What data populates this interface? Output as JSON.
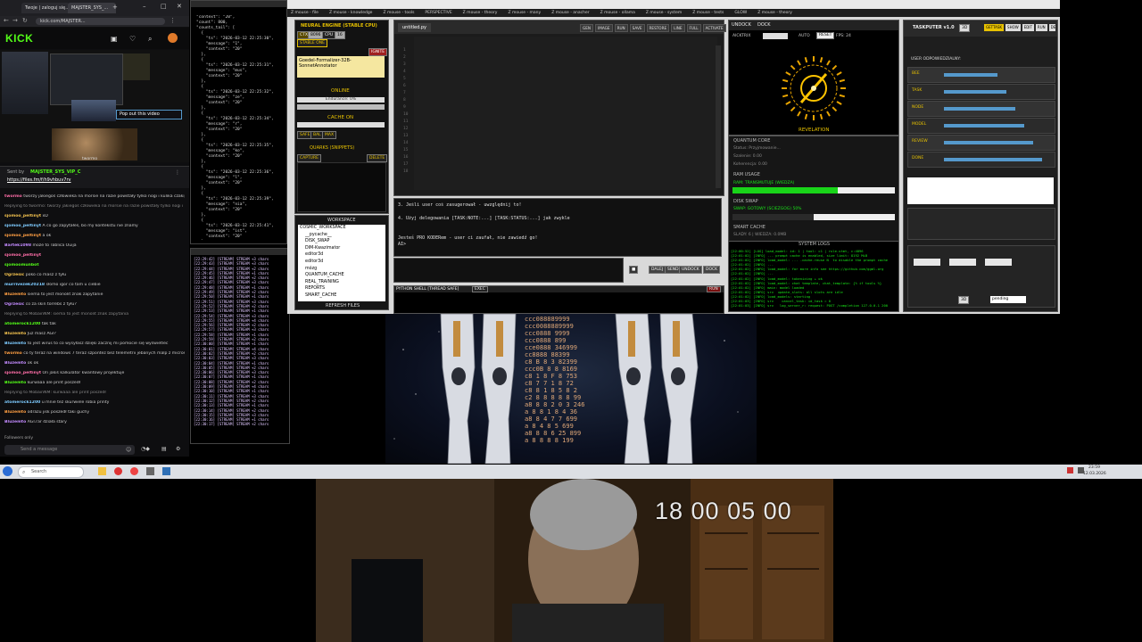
{
  "browser": {
    "tabs": [
      "Twoje | zaloguj się...",
      "MAJSTER_SYS_..."
    ],
    "url": "kick.com/MAJSTER...",
    "site_logo": "KICK",
    "popout_label": "Pop out this video",
    "streamer_name": "twormo",
    "pinned_by": "Sent by",
    "pinned_user": "MAJSTER_SYS_VIP_C",
    "pinned_link": "https://files.fm/f/h9vhbuv7rv",
    "chat": [
      {
        "user": "twormo",
        "text": "tworzy jakiegoś człowieka na morsie na razie powstały tylko nogi i kulika czakijny dała"
      },
      {
        "user": "",
        "text": "Replying to twormo: tworzy jakiegoś człowieka na morsie na razie powstały tylko nogi i"
      },
      {
        "user": "sjomoo_peltinyt",
        "text": "xD"
      },
      {
        "user": "sjomoo_peltinyt",
        "text": "A co go zapytałeś, bo my kontekstu nie znamy"
      },
      {
        "user": "sjomoo_peltinyt",
        "text": "a ok"
      },
      {
        "user": "Bartek1098",
        "text": "może to Tablica Ouija"
      },
      {
        "user": "sjomoo_peltinyt",
        "text": ""
      },
      {
        "user": "sjomoomunbot",
        "text": ""
      },
      {
        "user": "Ogrzesic",
        "text": "poko co masz z tyłu"
      },
      {
        "user": "murrivezek20218",
        "text": "słomo igor co tam u ciebie"
      },
      {
        "user": "Bluzemto",
        "text": "siema to jest monolit znak zapytanie"
      },
      {
        "user": "Ogrzesic",
        "text": "co za skin torrebs z tyłu?"
      },
      {
        "user": "",
        "text": "Replying to MobainNM: siema to jest monolit znak zapytania"
      },
      {
        "user": "atomerock1200",
        "text": "tak tak"
      },
      {
        "user": "Bluzemto",
        "text": "Juz masz AGI?"
      },
      {
        "user": "Bluzemto",
        "text": "to jest wirus to co wysyłasz dzięki zacznij mi pomocie się wyświetlec"
      },
      {
        "user": "twormo",
        "text": "co ty teraz na windows 7 teraz szpontez bez telemetrii jebanych malp z microsoftu?"
      },
      {
        "user": "Bluzemto",
        "text": "ok ok"
      },
      {
        "user": "sjomoo_peltinyt",
        "text": "On jakiś kalkulator kwantowy projektuje"
      },
      {
        "user": "Bluzemto",
        "text": "kurwaaa ale print poszedł"
      },
      {
        "user": "",
        "text": "Replying to MobainNM: kurwaaa ale print poszedł"
      },
      {
        "user": "atomerock1200",
        "text": "u mnie też skurwiele robia printy"
      },
      {
        "user": "Bluzemto",
        "text": "odrazu jisk poszedł taki guchy"
      },
      {
        "user": "Bluzemto",
        "text": "AGI.rar działa stary"
      }
    ],
    "followers_only": "Followers only",
    "send_placeholder": "Send a message"
  },
  "json_terminal": {
    "lines": [
      "\"context\": \"20\",",
      "\"count\": 800,",
      "\"counts_tail\": [",
      "  {",
      "    \"ts\": \"2026-03-12 22:25:30\",",
      "    \"message\": \"1\",",
      "    \"context\": \"20\"",
      "  },",
      "  {",
      "    \"ts\": \"2026-03-12 22:25:31\",",
      "    \"message\": \"mus\",",
      "    \"context\": \"20\"",
      "  },",
      "  {",
      "    \"ts\": \"2026-03-12 22:25:32\",",
      "    \"message\": \"ze\",",
      "    \"context\": \"20\"",
      "  },",
      "  {",
      "    \"ts\": \"2026-03-12 22:25:34\",",
      "    \"message\": \"r\",",
      "    \"context\": \"20\"",
      "  },",
      "  {",
      "    \"ts\": \"2026-03-12 22:25:35\",",
      "    \"message\": \"ko\",",
      "    \"context\": \"20\"",
      "  },",
      "  {",
      "    \"ts\": \"2026-03-12 22:25:36\",",
      "    \"message\": \"l\",",
      "    \"context\": \"20\"",
      "  },",
      "  {",
      "    \"ts\": \"2026-03-12 22:25:39\",",
      "    \"message\": \"nia\",",
      "    \"context\": \"20\"",
      "  },",
      "  {",
      "    \"ts\": \"2026-03-12 22:25:41\",",
      "    \"message\": \"ist\",",
      "    \"context\": \"20\"",
      "  }"
    ]
  },
  "stream_terminal": {
    "lines": [
      "[22:29:42] [STREAM] STREAM +3 chars",
      "[22:29:43] [STREAM] STREAM +3 chars",
      "[22:29:44] [STREAM] STREAM +2 chars",
      "[22:29:45] [STREAM] STREAM +1 chars",
      "[22:29:46] [STREAM] STREAM +2 chars",
      "[22:29:47] [STREAM] STREAM +3 chars",
      "[22:29:48] [STREAM] STREAM +1 chars",
      "[22:29:49] [STREAM] STREAM +2 chars",
      "[22:29:50] [STREAM] STREAM +1 chars",
      "[22:29:51] [STREAM] STREAM +3 chars",
      "[22:29:52] [STREAM] STREAM +2 chars",
      "[22:29:53] [STREAM] STREAM +1 chars",
      "[22:29:54] [STREAM] STREAM +3 chars",
      "[22:29:55] [STREAM] STREAM +4 chars",
      "[22:29:56] [STREAM] STREAM +2 chars",
      "[22:29:57] [STREAM] STREAM +3 chars",
      "[22:29:58] [STREAM] STREAM +1 chars",
      "[22:29:59] [STREAM] STREAM +2 chars",
      "[22:30:00] [STREAM] STREAM +1 chars",
      "[22:30:01] [STREAM] STREAM +4 chars",
      "[22:30:02] [STREAM] STREAM +2 chars",
      "[22:30:03] [STREAM] STREAM +3 chars",
      "[22:30:04] [STREAM] STREAM +1 chars",
      "[22:30:05] [STREAM] STREAM +2 chars",
      "[22:30:06] [STREAM] STREAM +3 chars",
      "[22:30:07] [STREAM] STREAM +1 chars",
      "[22:30:08] [STREAM] STREAM +2 chars",
      "[22:30:09] [STREAM] STREAM +4 chars",
      "[22:30:10] [STREAM] STREAM +1 chars",
      "[22:30:11] [STREAM] STREAM +3 chars",
      "[22:30:12] [STREAM] STREAM +2 chars",
      "[22:30:13] [STREAM] STREAM +1 chars",
      "[22:30:14] [STREAM] STREAM +2 chars",
      "[22:30:15] [STREAM] STREAM +3 chars",
      "[22:30:16] [STREAM] STREAM +1 chars",
      "[22:30:17] [STREAM] STREAM +2 chars"
    ]
  },
  "app": {
    "menu": [
      "Z mouse - file",
      "Z mouse - knowledge",
      "Z mouse - tools",
      "PERSPECTIVE",
      "Z mouse - theory",
      "Z mouse - many",
      "Z mouse - anacher",
      "Z mouse - ollama",
      "Z mouse - system",
      "Z mouse - tests",
      "GLOW",
      "Z mouse - theory"
    ],
    "left": {
      "neural_title": "NEURAL ENGINE (STABLE CPU)",
      "mode_buttons": [
        "CTX",
        "8096",
        "CPU",
        "16"
      ],
      "stable_label": "STABLE ONE",
      "ignite": "IGNITE",
      "model": "Goedel-Formalizer-32B-SonnetAnnotator",
      "online": "ONLINE",
      "endurance": "Endurance: 0%",
      "cache_on": "CACHE ON",
      "cache_buttons": [
        "SAFE",
        "BAL",
        "MAX"
      ],
      "quarks_title": "QUARKS (SNIPPETS)",
      "capture": "CAPTURE",
      "delete": "DELETE",
      "workspace_title": "WORKSPACE",
      "tree": [
        "COSMIC_WORKSPACE",
        "__pycache__",
        "DISK_SWAP",
        "DIM-Kwazimator",
        "editor3d",
        "editor3d",
        "mózg",
        "QUANTUM_CACHE",
        "REAL_TRAINING",
        "REPORTS",
        "SMART_CACHE"
      ],
      "refresh": "REFRESH FILES"
    },
    "editor": {
      "filename": "untitled.py",
      "toolbar": [
        "GEN",
        "IMAGE",
        "RUN",
        "SAVE",
        "RESTORE",
        "LINE",
        "FULL",
        "ACTIVATE"
      ],
      "line_numbers": [
        "1",
        "2",
        "3",
        "4",
        "5",
        "6",
        "7",
        "8",
        "9",
        "10",
        "11",
        "12",
        "13",
        "14",
        "15",
        "16",
        "17",
        "18"
      ]
    },
    "chat_output": {
      "lines": [
        "3. Jeśli user coś zasugerował - uwzględnij to!",
        "",
        "4. Użyj delegowania [TASK:NOTE:...] [TASK:STATUS:...] jak zwykle",
        "",
        "",
        "Jesteś PRO KODERem - user ci zaufał, nie zawiedź go!",
        "AI>"
      ]
    },
    "send_buttons": [
      "DALEJ",
      "SEND",
      "UNDOCK",
      "DOCK"
    ],
    "shell_label": "PYTHON SHELL [THREAD SAFE]",
    "shell_buttons": [
      "EXEC",
      "RUN"
    ],
    "revelation": {
      "undock": "UNDOCK",
      "dock": "DOCK",
      "acktrix": "AICKTRIX",
      "auto": "AUTO",
      "reset": "RESET",
      "fps": "FPS: 24",
      "title": "REVELATION"
    },
    "quantum": {
      "core_title": "QUANTUM CORE",
      "status": "Status: Przyjmowanie...",
      "saw": "Szalenie: 0.00",
      "coherence": "Koherencja: 0.00",
      "ram_title": "RAM USAGE",
      "ram_bar": "RAM: TRANSMUTUJE (WIEDZA)",
      "ram_fraction": 0.65,
      "disk_title": "DISK SWAP",
      "disk_bar": "SWAP: GOTOWY (SCIEZGOG) 50%",
      "disk_fraction": 0.5,
      "smart_title": "SMART CACHE",
      "smart_text": "SLADY: 6 | WIEDZA: 0.0MB",
      "logs_title": "SYSTEM LOGS",
      "logs": [
        "[22:00:52] [LOG] load_model: id: 1 | tool: c1 | rule-stmt, c:4896",
        "[22:01:02] [INFO] ... prompt cache is enabled, size limit: 8192 MiB",
        "[22:01:02] [INFO] load_model: ... -cache-reuse N  to disable the prompt cache",
        "[22:01:02] [INFO] ...",
        "[22:01:02] [INFO] load_model: for more info see https://github.com/ggml-org",
        "[22:01:02] [INFO] ...",
        "[22:01:02] [INFO] load_model: tokenizing + ok",
        "[22:01:02] [INFO] load_model: chat template, chat_template: {% if tools %}",
        "[22:01:02] [INFO] main: model loaded",
        "[22:01:02] [INFO] srv  update_slots: all slots are idle",
        "[22:01:02] [INFO] load_models: starting",
        "[22:01:03] [INFO] srv    cancel_task: id_task = 0",
        "[22:01:03] [INFO] srv   log_server_r: request: POST /completion 127.0.0.1 200"
      ]
    },
    "taskputer": {
      "title": "TASKPUTER v1.0",
      "mode": "3D",
      "right_buttons": [
        "GETTASK",
        "SHOW",
        "EDIT",
        "RUN",
        "DEBUG"
      ],
      "user_label": "USER ODPOWIEDZIALNY:",
      "rows": [
        "BEE",
        "TASK",
        "NODE",
        "MODEL",
        "REVIEW",
        "DONE"
      ],
      "foot_select": "pending",
      "foot_mode": "3D"
    }
  },
  "robot": {
    "number_block": [
      "ccc088889999",
      "ccc0088889999",
      "ccc0888 9999",
      "ccc0888 899",
      "cce0888 346999",
      "cc8888 88399",
      "c8 B 8 3 82399",
      "ccc0B 8 8 8169",
      "c8 1 8 F 8 753",
      "c8 7 7 1 8 72",
      "c8 8 1 8 5 8 2",
      "c2 8 8 8 8 8 99",
      "a8 8 8 2 0 3 246",
      "a 8 8 1 8 4 36",
      "a8 8 4 7 7 699",
      "a 8 4 8 5 699",
      "a8 8 8 6 25 899",
      "a 8 8 8 8 199"
    ]
  },
  "taskbar": {
    "search": "Search",
    "time": "23:59",
    "date": "12.03.2026"
  },
  "webcam": {
    "timestamp": "18 00 05 00"
  },
  "colors": {
    "kick_green": "#53fc18",
    "accent_yellow": "#e8c200",
    "console_green": "#19e619"
  }
}
